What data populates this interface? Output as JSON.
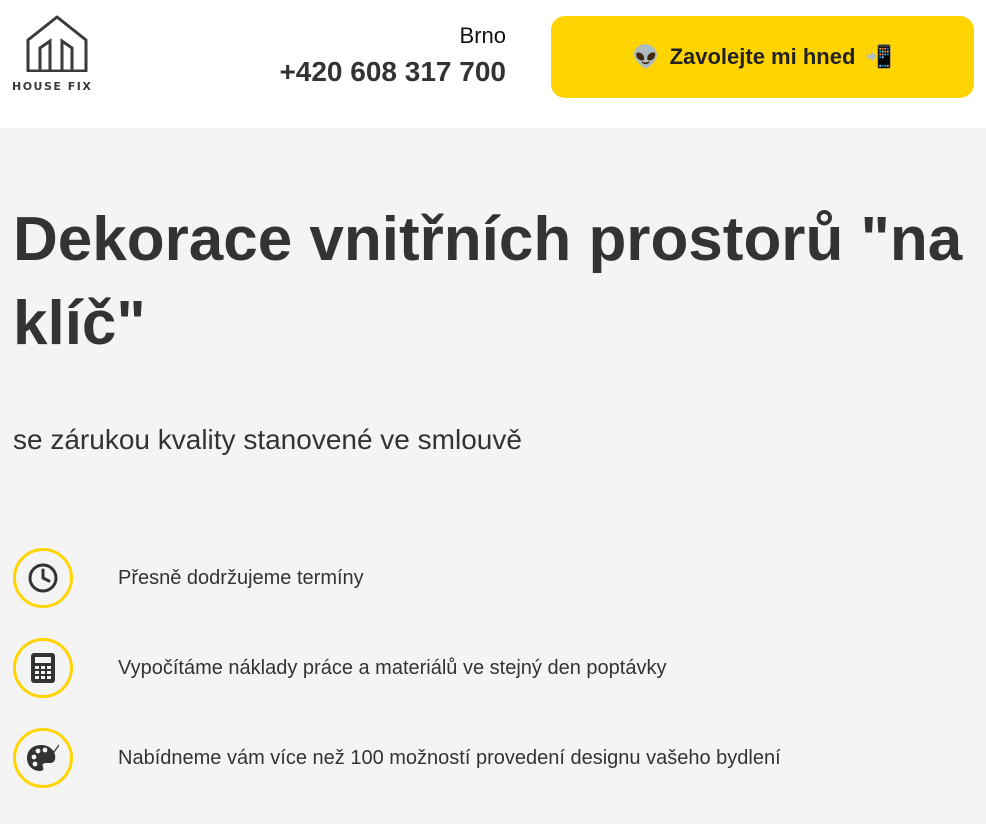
{
  "header": {
    "logo_text": "HOUSE FIX",
    "city": "Brno",
    "phone": "+420 608 317 700",
    "cta": {
      "label": "Zavolejte mi hned",
      "icon_left": "👽",
      "icon_right": "📲"
    }
  },
  "hero": {
    "title": "Dekorace vnitřních prostorů \"na klíč\"",
    "subtitle": "se zárukou kvality stanovené ve smlouvě"
  },
  "features": [
    {
      "icon": "clock-icon",
      "text": "Přesně dodržujeme termíny"
    },
    {
      "icon": "calculator-icon",
      "text": "Vypočítáme náklady práce a materiálů ve stejný den poptávky"
    },
    {
      "icon": "palette-icon",
      "text": "Nabídneme vám více než 100 možností provedení designu vašeho bydlení"
    }
  ],
  "colors": {
    "accent": "#ffd400",
    "text": "#333333",
    "background": "#f4f4f4",
    "header_bg": "#ffffff"
  }
}
